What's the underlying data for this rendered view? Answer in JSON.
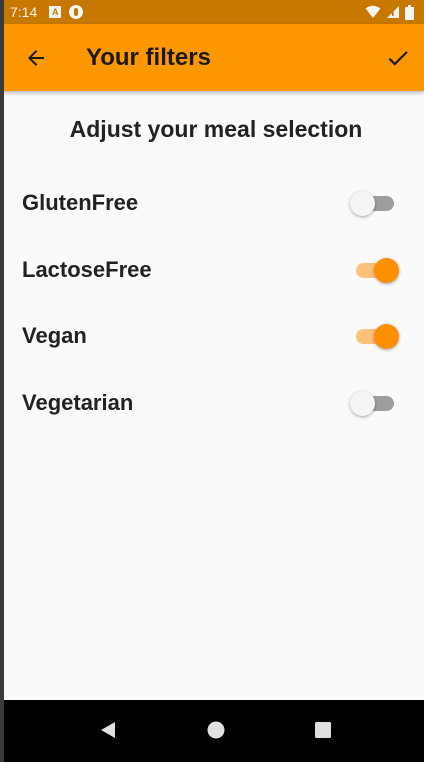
{
  "status_bar": {
    "time": "7:14",
    "icons": [
      "android-notification-icon",
      "pocket-casts-icon",
      "wifi-icon",
      "signal-icon",
      "battery-icon"
    ]
  },
  "app_bar": {
    "title": "Your filters",
    "back_icon": "arrow-left-icon",
    "save_icon": "check-icon",
    "background": "#ff9800"
  },
  "content": {
    "heading": "Adjust your meal selection",
    "filters": [
      {
        "label": "GlutenFree",
        "enabled": false
      },
      {
        "label": "LactoseFree",
        "enabled": true
      },
      {
        "label": "Vegan",
        "enabled": true
      },
      {
        "label": "Vegetarian",
        "enabled": false
      }
    ]
  },
  "nav_bar": {
    "buttons": [
      "back-triangle-icon",
      "home-circle-icon",
      "recents-square-icon"
    ]
  },
  "colors": {
    "accent": "#ff9800",
    "status_bar": "#c77800",
    "switch_on": "#ff8f00"
  }
}
